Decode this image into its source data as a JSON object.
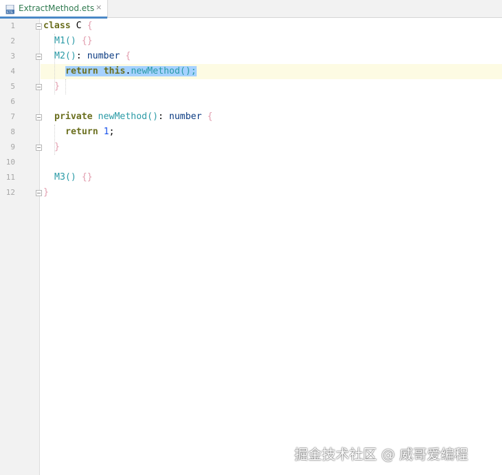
{
  "tab": {
    "file_name": "ExtractMethod.ets",
    "close_glyph": "×",
    "icon": "ets-file-icon"
  },
  "gutter": {
    "line_numbers": [
      "1",
      "2",
      "3",
      "4",
      "5",
      "6",
      "7",
      "8",
      "9",
      "10",
      "11",
      "12"
    ]
  },
  "code": {
    "l1": {
      "kw": "class",
      "name": "C",
      "brace": "{"
    },
    "l2": {
      "method": "M1",
      "parens": "()",
      "braces": "{}"
    },
    "l3": {
      "method": "M2",
      "parens": "()",
      "colon": ":",
      "type": "number",
      "brace": "{"
    },
    "l4": {
      "kw": "return",
      "this": "this",
      "dot": ".",
      "call": "newMethod",
      "parens": "();"
    },
    "l5": {
      "brace": "}"
    },
    "l7": {
      "kw": "private",
      "method": "newMethod",
      "parens": "()",
      "colon": ":",
      "type": "number",
      "brace": "{"
    },
    "l8": {
      "kw": "return",
      "value": "1",
      "semi": ";"
    },
    "l9": {
      "brace": "}"
    },
    "l11": {
      "method": "M3",
      "parens": "()",
      "braces": "{}"
    },
    "l12": {
      "brace": "}"
    }
  },
  "watermark": "掘金技术社区 @ 威哥爱编程",
  "colors": {
    "keyword": "#0b3b82",
    "method": "#2a9aa6",
    "selection": "#a6d2ff",
    "caret_row": "#fdfbe3",
    "brace": "#e29dae"
  }
}
